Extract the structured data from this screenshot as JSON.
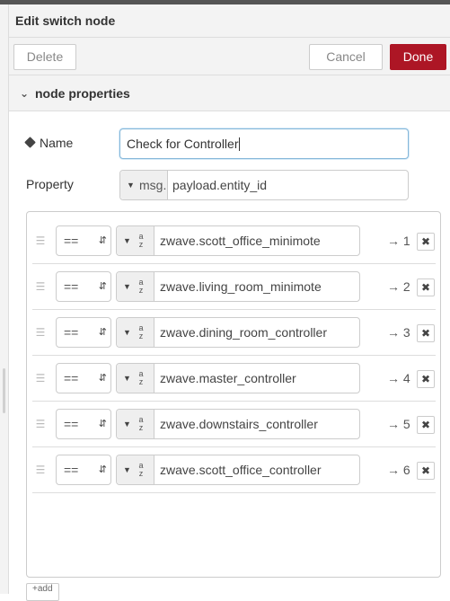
{
  "dialog": {
    "title": "Edit switch node"
  },
  "toolbar": {
    "delete_label": "Delete",
    "cancel_label": "Cancel",
    "done_label": "Done"
  },
  "section": {
    "label": "node properties",
    "chevron_icon": "chevron-down-icon"
  },
  "name": {
    "label": "Name",
    "value": "Check for Controller",
    "icon": "tag-icon"
  },
  "property": {
    "label": "Property",
    "type": "msg.",
    "value": "payload.entity_id"
  },
  "rules": [
    {
      "operator": "==",
      "type": "az",
      "value": "zwave.scott_office_minimote",
      "output": "→ 1"
    },
    {
      "operator": "==",
      "type": "az",
      "value": "zwave.living_room_minimote",
      "output": "→ 2"
    },
    {
      "operator": "==",
      "type": "az",
      "value": "zwave.dining_room_controller",
      "output": "→ 3"
    },
    {
      "operator": "==",
      "type": "az",
      "value": "zwave.master_controller",
      "output": "→ 4"
    },
    {
      "operator": "==",
      "type": "az",
      "value": " zwave.downstairs_controller",
      "output": "→ 5"
    },
    {
      "operator": "==",
      "type": "az",
      "value": "zwave.scott_office_controller",
      "output": "→ 6"
    }
  ],
  "add": {
    "label": "add"
  },
  "colors": {
    "done": "#ad1625",
    "focus_border": "#85b7d9"
  }
}
